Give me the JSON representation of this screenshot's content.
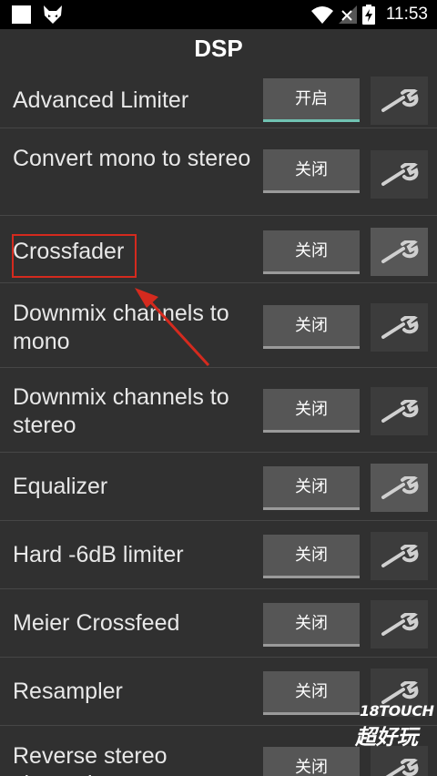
{
  "status_bar": {
    "time": "11:53",
    "icons": [
      "square-icon",
      "fox-app-icon",
      "wifi-icon",
      "no-signal-icon",
      "battery-charging-icon"
    ]
  },
  "header": {
    "title": "DSP"
  },
  "dsp_items": [
    {
      "label": "Advanced Limiter",
      "toggle": "开启",
      "on": true
    },
    {
      "label": "Convert mono to stereo",
      "toggle": "关闭",
      "on": false
    },
    {
      "label": "Crossfader",
      "toggle": "关闭",
      "on": false
    },
    {
      "label": "Downmix channels to mono",
      "toggle": "关闭",
      "on": false
    },
    {
      "label": "Downmix channels to stereo",
      "toggle": "关闭",
      "on": false
    },
    {
      "label": "Equalizer",
      "toggle": "关闭",
      "on": false
    },
    {
      "label": "Hard -6dB limiter",
      "toggle": "关闭",
      "on": false
    },
    {
      "label": "Meier Crossfeed",
      "toggle": "关闭",
      "on": false
    },
    {
      "label": "Resampler",
      "toggle": "关闭",
      "on": false
    },
    {
      "label": "Reverse stereo channels",
      "toggle": "关闭",
      "on": false
    }
  ],
  "watermark": {
    "text": "18TOUCH",
    "logo": "超好玩"
  },
  "colors": {
    "background": "#303030",
    "button": "#565656",
    "on_underline": "#70c2b2",
    "annotation_red": "#d42a1e"
  }
}
